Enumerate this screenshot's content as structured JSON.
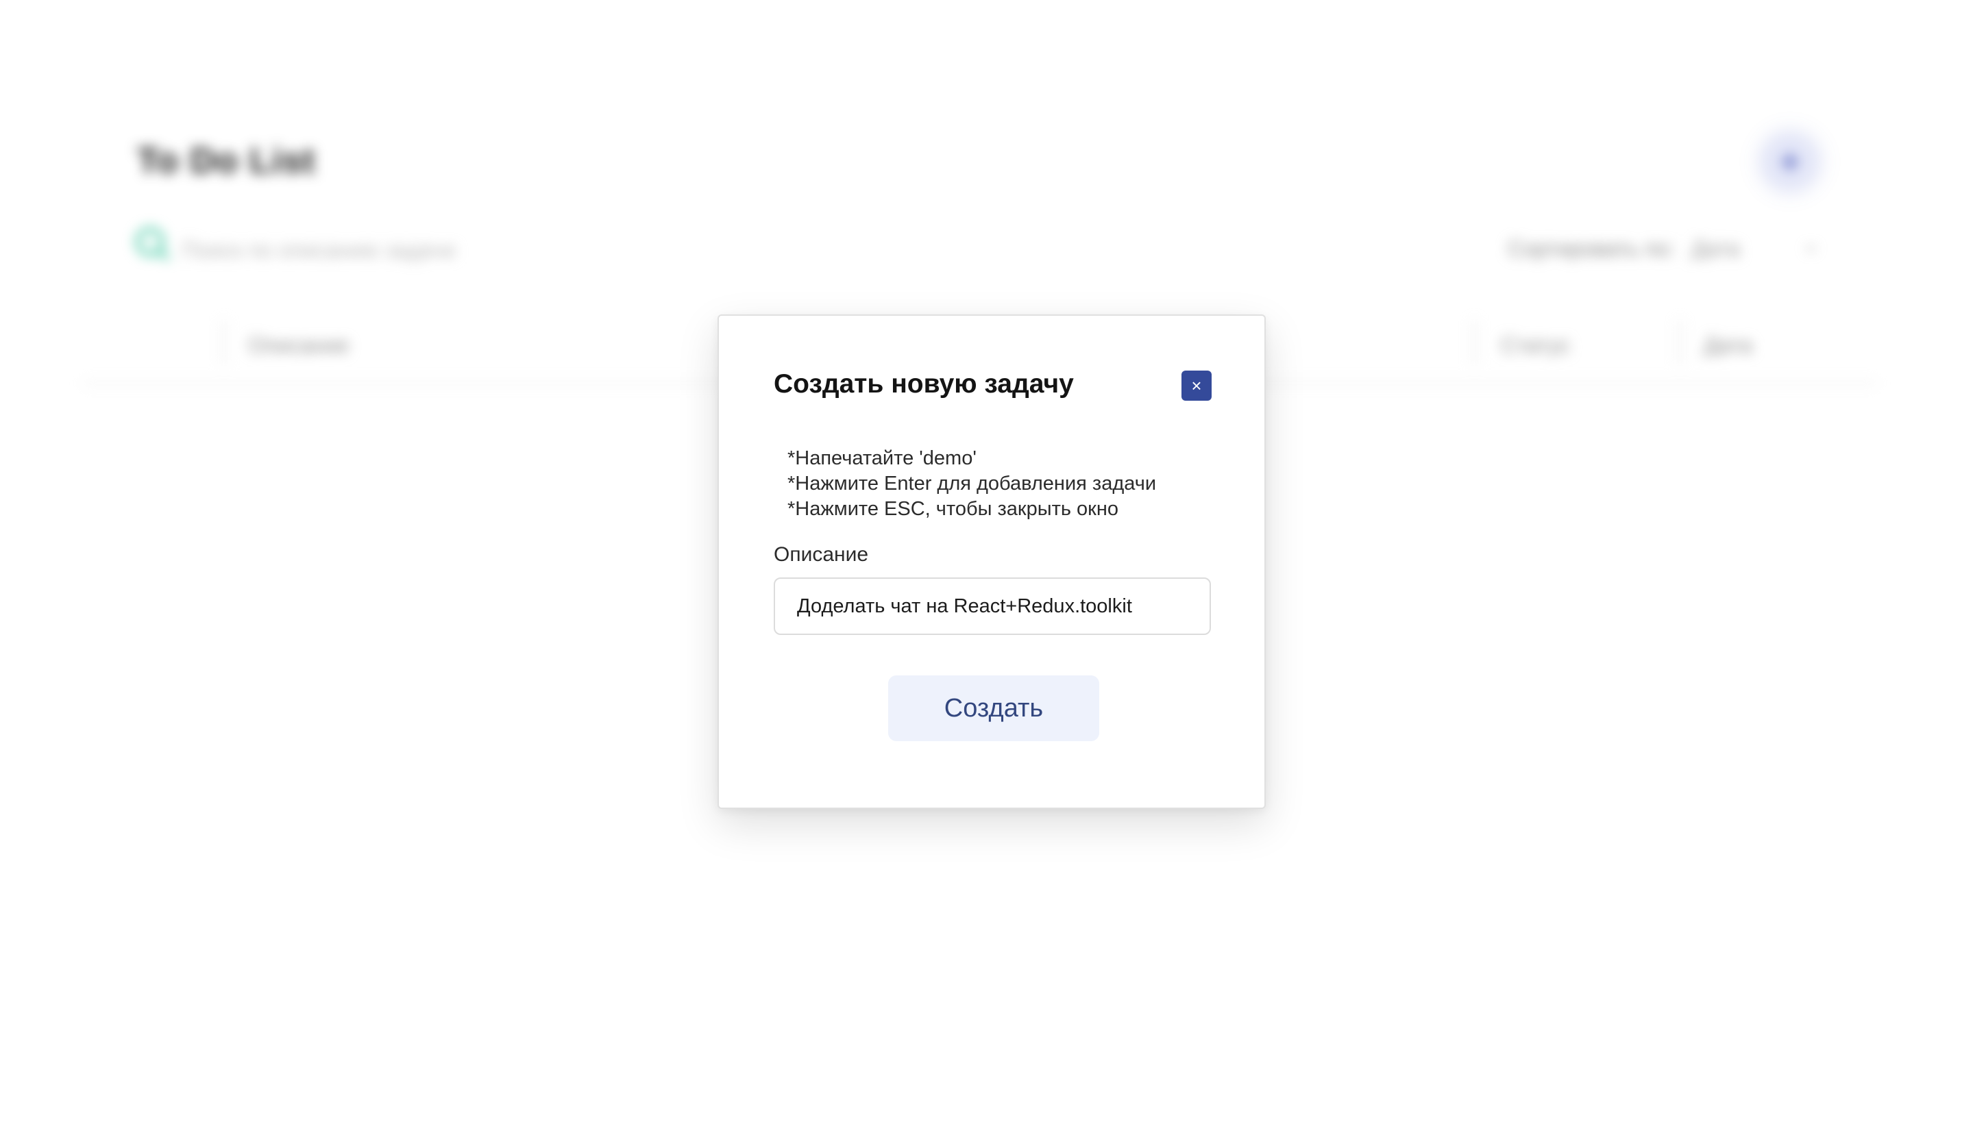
{
  "app": {
    "title": "To Do List",
    "add_button_symbol": "+",
    "search": {
      "icon": "search-icon",
      "placeholder": "Поиск по описанию задачи"
    },
    "sort": {
      "label": "Сортировать по:",
      "value": "Дата",
      "chevron": "⌄"
    },
    "table": {
      "columns": [
        "Описание",
        "Статус",
        "Дата"
      ]
    }
  },
  "modal": {
    "title": "Создать новую задачу",
    "close_symbol": "×",
    "hints": [
      "*Напечатайте 'demo'",
      "*Нажмите Enter для добавления задачи",
      "*Нажмите ESC, чтобы закрыть окно"
    ],
    "field_label": "Описание",
    "field_value": "Доделать чат на React+Redux.toolkit",
    "submit_label": "Создать"
  },
  "colors": {
    "accent": "#344a9a",
    "button_bg": "#eef2fc",
    "search_icon": "#47c9a4"
  }
}
